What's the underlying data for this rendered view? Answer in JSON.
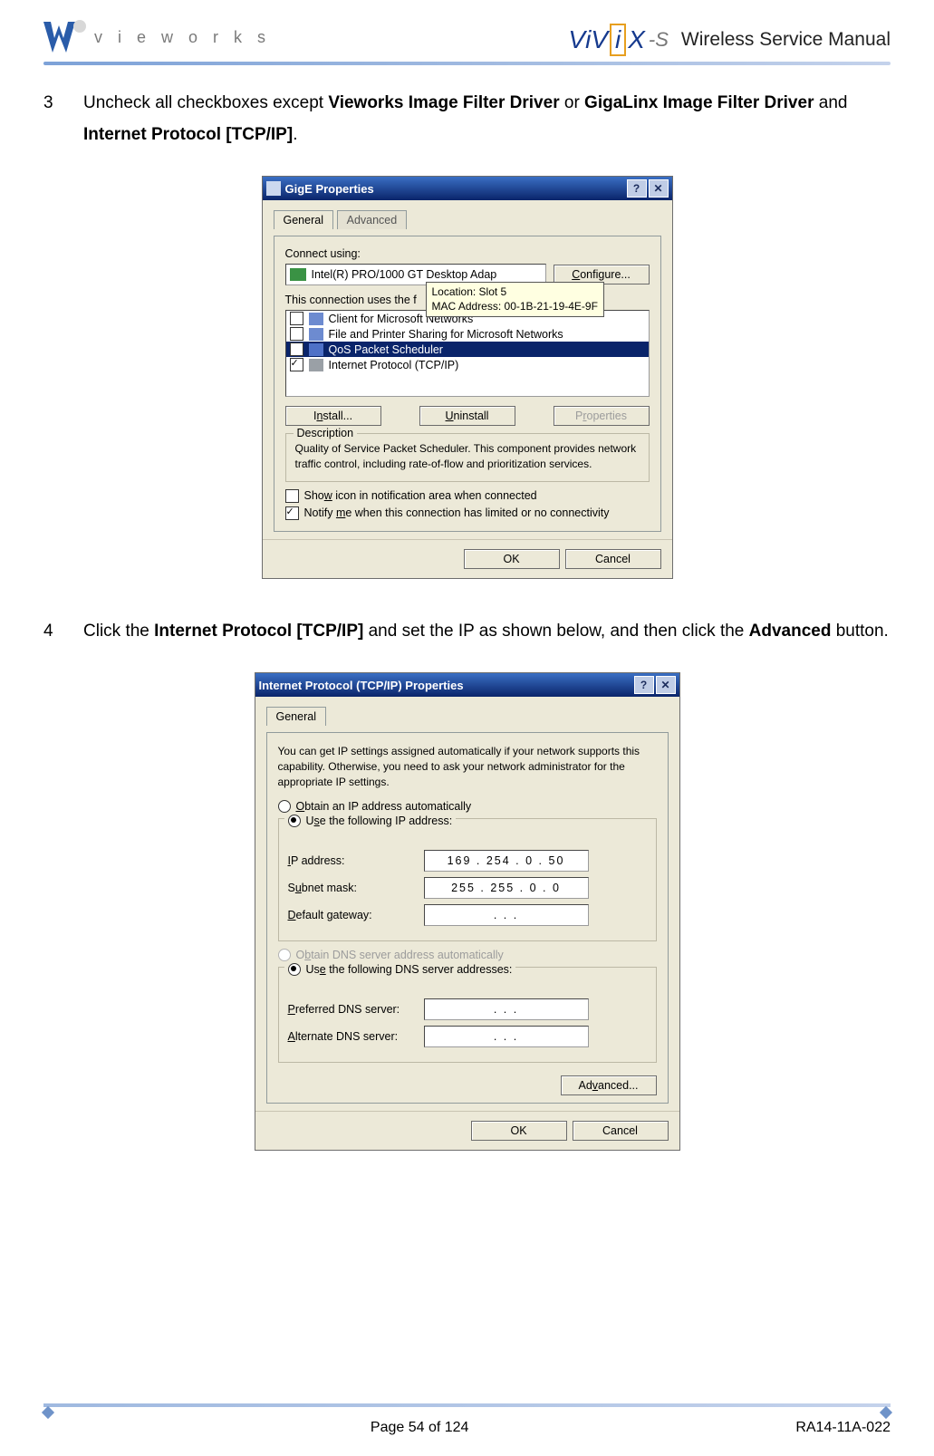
{
  "header": {
    "logo_text": "v i e w o r k s",
    "product": "ViViX",
    "product_suffix": "-S",
    "doc_title": "Wireless Service Manual"
  },
  "steps": {
    "s3": {
      "num": "3",
      "pre": "Uncheck all checkboxes except ",
      "b1": "Vieworks Image Filter Driver",
      "mid1": " or ",
      "b2": "GigaLinx Image Filter Driver",
      "mid2": " and ",
      "b3": "Internet Protocol [TCP/IP]",
      "post": "."
    },
    "s4": {
      "num": "4",
      "pre": "Click the ",
      "b1": "Internet Protocol [TCP/IP]",
      "mid": " and set the IP as shown below, and then click the ",
      "b2": "Advanced",
      "post": " button."
    }
  },
  "dialog1": {
    "title": "GigE Properties",
    "tabs": [
      "General",
      "Advanced"
    ],
    "connect_label": "Connect using:",
    "adapter": "Intel(R) PRO/1000 GT Desktop Adap",
    "configure": "Configure...",
    "uses_label": "This connection uses the f",
    "tooltip_l1": "Location: Slot 5",
    "tooltip_l2": "MAC Address: 00-1B-21-19-4E-9F",
    "items": [
      {
        "label": "Client for Microsoft Networks",
        "checked": false
      },
      {
        "label": "File and Printer Sharing for Microsoft Networks",
        "checked": false
      },
      {
        "label": "QoS Packet Scheduler",
        "checked": false,
        "selected": true
      },
      {
        "label": "Internet Protocol (TCP/IP)",
        "checked": true
      }
    ],
    "install": "Install...",
    "uninstall": "Uninstall",
    "properties": "Properties",
    "desc_legend": "Description",
    "desc_text": "Quality of Service Packet Scheduler. This component provides network traffic control, including rate-of-flow and prioritization services.",
    "show_icon": "Show icon in notification area when connected",
    "notify": "Notify me when this connection has limited or no connectivity",
    "ok": "OK",
    "cancel": "Cancel"
  },
  "dialog2": {
    "title": "Internet Protocol (TCP/IP) Properties",
    "tab": "General",
    "intro": "You can get IP settings assigned automatically if your network supports this capability. Otherwise, you need to ask your network administrator for the appropriate IP settings.",
    "obtain_ip": "Obtain an IP address automatically",
    "use_ip": "Use the following IP address:",
    "ip_label": "IP address:",
    "ip_value": "169 . 254 .   0  .  50",
    "subnet_label": "Subnet mask:",
    "subnet_value": "255 . 255 .   0  .   0",
    "gateway_label": "Default gateway:",
    "gateway_value": ".        .        .",
    "obtain_dns": "Obtain DNS server address automatically",
    "use_dns": "Use the following DNS server addresses:",
    "pref_dns_label": "Preferred DNS server:",
    "pref_dns_value": ".        .        .",
    "alt_dns_label": "Alternate DNS server:",
    "alt_dns_value": ".        .        .",
    "advanced": "Advanced...",
    "ok": "OK",
    "cancel": "Cancel"
  },
  "footer": {
    "page": "Page 54 of 124",
    "docnum": "RA14-11A-022"
  }
}
